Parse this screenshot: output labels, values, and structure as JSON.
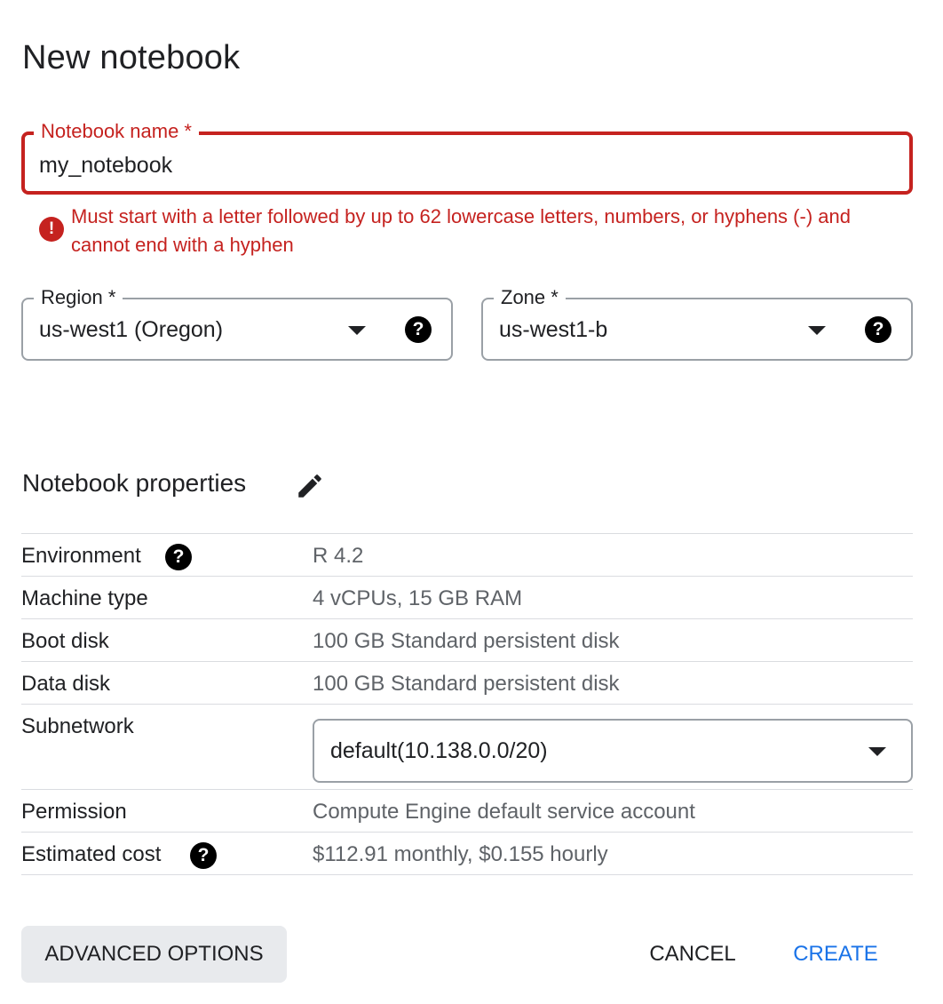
{
  "dialog": {
    "title": "New notebook"
  },
  "name_field": {
    "label": "Notebook name *",
    "value": "my_notebook",
    "error": "Must start with a letter followed by up to 62 lowercase letters, numbers, or hyphens (-) and cannot end with a hyphen",
    "error_icon": "!"
  },
  "region": {
    "label": "Region *",
    "value": "us-west1 (Oregon)"
  },
  "zone": {
    "label": "Zone *",
    "value": "us-west1-b"
  },
  "help_icon": "?",
  "properties": {
    "title": "Notebook properties",
    "rows": [
      {
        "label": "Environment",
        "value": "R 4.2"
      },
      {
        "label": "Machine type",
        "value": "4 vCPUs, 15 GB RAM"
      },
      {
        "label": "Boot disk",
        "value": "100 GB Standard persistent disk"
      },
      {
        "label": "Data disk",
        "value": "100 GB Standard persistent disk"
      },
      {
        "label": "Subnetwork",
        "value": "default(10.138.0.0/20)"
      },
      {
        "label": "Permission",
        "value": "Compute Engine default service account"
      },
      {
        "label": "Estimated cost",
        "value": "$112.91 monthly, $0.155 hourly"
      }
    ]
  },
  "buttons": {
    "advanced": "ADVANCED OPTIONS",
    "cancel": "CANCEL",
    "create": "CREATE"
  },
  "colors": {
    "error": "#c5221f",
    "primary": "#1a73e8",
    "text": "#202124",
    "secondary_text": "#5f6368",
    "button_bg": "#e8eaed"
  }
}
